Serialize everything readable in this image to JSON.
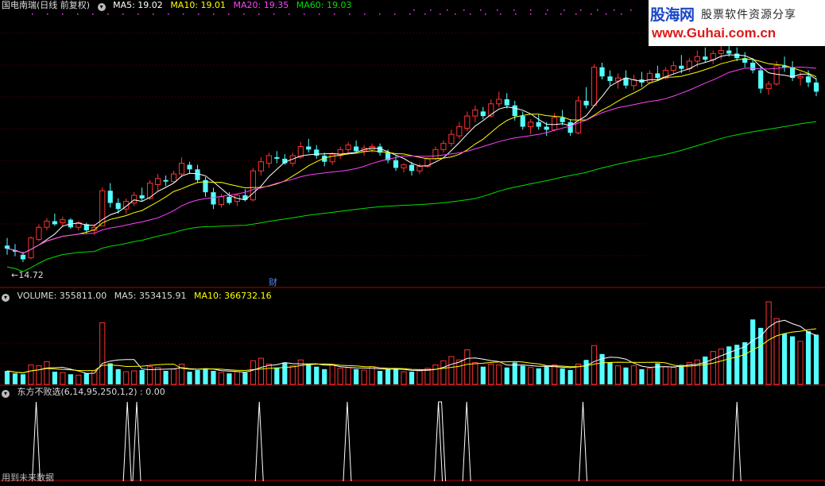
{
  "header": {
    "stock_name": "国电南瑞(日线 前复权)",
    "ma5": "MA5: 19.02",
    "ma10": "MA10: 19.01",
    "ma20": "MA20: 19.35",
    "ma60": "MA60: 19.03"
  },
  "volume_header": {
    "label": "VOLUME: 355811.00",
    "ma5": "MA5: 353415.91",
    "ma10": "MA10: 366732.16"
  },
  "indicator_header": {
    "label": "东方不败选(6,14,95,250,1,2)  : 0.00"
  },
  "logo": {
    "brand": "股海网",
    "slogan": "股票软件资源分享",
    "url": "www.Guhai.com.cn"
  },
  "low_marker": "←14.72",
  "finance_badge": "财",
  "bottom_note": "用到未来数据",
  "colors": {
    "up": "#ff3232",
    "down": "#54ffff",
    "ma5": "#ffffff",
    "ma10": "#ffff00",
    "ma20": "#ff40ff",
    "ma60": "#00e000",
    "grid": "#6a0000",
    "signal": "#ffffff"
  },
  "chart_data": {
    "type": "candlestick",
    "price_min_visible": 14.72,
    "ohlc": [
      [
        15.8,
        16.3,
        15.2,
        15.6
      ],
      [
        15.5,
        15.9,
        15.1,
        15.4
      ],
      [
        15.2,
        15.4,
        14.72,
        14.9
      ],
      [
        15.0,
        16.4,
        14.9,
        16.3
      ],
      [
        16.2,
        17.2,
        16.1,
        17.0
      ],
      [
        17.0,
        17.6,
        16.8,
        17.4
      ],
      [
        17.4,
        17.9,
        17.1,
        17.2
      ],
      [
        17.3,
        17.7,
        17.0,
        17.5
      ],
      [
        17.5,
        17.6,
        16.9,
        17.0
      ],
      [
        17.0,
        17.4,
        16.8,
        17.3
      ],
      [
        17.2,
        17.3,
        16.6,
        16.8
      ],
      [
        16.8,
        17.2,
        16.5,
        17.0
      ],
      [
        17.1,
        19.6,
        17.1,
        19.4
      ],
      [
        19.4,
        19.9,
        18.3,
        18.6
      ],
      [
        18.6,
        18.9,
        17.9,
        18.2
      ],
      [
        18.2,
        18.9,
        17.9,
        18.7
      ],
      [
        18.6,
        19.3,
        18.4,
        19.1
      ],
      [
        19.1,
        19.6,
        18.7,
        18.9
      ],
      [
        18.9,
        20.1,
        18.8,
        19.9
      ],
      [
        19.8,
        20.5,
        19.4,
        20.2
      ],
      [
        20.1,
        20.4,
        19.7,
        20.0
      ],
      [
        20.0,
        20.7,
        19.9,
        20.5
      ],
      [
        20.5,
        21.6,
        20.3,
        21.2
      ],
      [
        21.1,
        21.3,
        20.5,
        20.8
      ],
      [
        20.8,
        21.1,
        19.9,
        20.1
      ],
      [
        20.1,
        20.3,
        19.0,
        19.3
      ],
      [
        19.3,
        19.6,
        18.2,
        18.5
      ],
      [
        18.5,
        19.2,
        18.3,
        19.0
      ],
      [
        19.0,
        19.3,
        18.5,
        18.6
      ],
      [
        18.7,
        19.2,
        18.4,
        19.1
      ],
      [
        19.1,
        19.5,
        18.7,
        18.8
      ],
      [
        18.8,
        20.9,
        18.7,
        20.7
      ],
      [
        20.7,
        21.6,
        20.4,
        21.3
      ],
      [
        21.2,
        21.9,
        20.9,
        21.7
      ],
      [
        21.6,
        22.0,
        21.2,
        21.5
      ],
      [
        21.5,
        21.8,
        21.1,
        21.2
      ],
      [
        21.2,
        21.9,
        21.0,
        21.7
      ],
      [
        21.6,
        22.6,
        21.5,
        22.3
      ],
      [
        22.3,
        22.8,
        21.9,
        22.1
      ],
      [
        22.1,
        22.4,
        21.5,
        21.7
      ],
      [
        21.7,
        21.9,
        21.0,
        21.3
      ],
      [
        21.3,
        21.9,
        21.1,
        21.8
      ],
      [
        21.7,
        22.3,
        21.5,
        22.1
      ],
      [
        22.1,
        22.6,
        21.8,
        22.4
      ],
      [
        22.3,
        22.7,
        21.9,
        22.0
      ],
      [
        22.0,
        22.4,
        21.7,
        22.2
      ],
      [
        22.1,
        22.5,
        21.9,
        22.3
      ],
      [
        22.3,
        22.5,
        21.7,
        21.9
      ],
      [
        21.9,
        22.1,
        21.2,
        21.4
      ],
      [
        21.4,
        21.7,
        20.7,
        20.9
      ],
      [
        20.9,
        21.2,
        20.6,
        21.1
      ],
      [
        21.1,
        21.3,
        20.4,
        20.7
      ],
      [
        20.7,
        21.2,
        20.5,
        21.0
      ],
      [
        21.0,
        21.6,
        20.9,
        21.5
      ],
      [
        21.5,
        22.3,
        21.4,
        22.1
      ],
      [
        22.1,
        22.7,
        21.9,
        22.5
      ],
      [
        22.5,
        23.4,
        22.3,
        23.1
      ],
      [
        23.0,
        23.9,
        22.8,
        23.6
      ],
      [
        23.5,
        24.6,
        23.3,
        24.3
      ],
      [
        24.3,
        25.0,
        23.9,
        24.7
      ],
      [
        24.6,
        24.9,
        24.1,
        24.3
      ],
      [
        24.3,
        25.4,
        24.2,
        25.1
      ],
      [
        25.1,
        25.9,
        24.9,
        25.4
      ],
      [
        25.4,
        25.8,
        24.8,
        25.0
      ],
      [
        25.0,
        25.3,
        24.0,
        24.3
      ],
      [
        24.3,
        24.6,
        23.4,
        23.6
      ],
      [
        23.6,
        24.1,
        23.1,
        23.9
      ],
      [
        23.9,
        24.4,
        23.4,
        23.6
      ],
      [
        23.6,
        23.9,
        23.0,
        23.4
      ],
      [
        23.4,
        24.5,
        23.3,
        24.2
      ],
      [
        24.2,
        24.7,
        23.7,
        23.9
      ],
      [
        23.9,
        24.1,
        23.0,
        23.2
      ],
      [
        23.2,
        25.6,
        23.1,
        25.3
      ],
      [
        25.3,
        26.2,
        24.8,
        25.0
      ],
      [
        25.0,
        27.7,
        25.0,
        27.5
      ],
      [
        27.5,
        27.8,
        26.7,
        26.9
      ],
      [
        26.9,
        27.3,
        26.3,
        26.6
      ],
      [
        26.6,
        27.1,
        26.1,
        26.8
      ],
      [
        26.8,
        27.3,
        26.1,
        26.3
      ],
      [
        26.3,
        27.0,
        26.0,
        26.7
      ],
      [
        26.7,
        27.2,
        26.2,
        26.5
      ],
      [
        26.5,
        27.3,
        26.4,
        27.1
      ],
      [
        27.1,
        27.6,
        26.6,
        26.8
      ],
      [
        26.8,
        27.5,
        26.7,
        27.3
      ],
      [
        27.3,
        27.9,
        27.0,
        27.6
      ],
      [
        27.6,
        28.3,
        27.1,
        27.4
      ],
      [
        27.4,
        28.1,
        27.2,
        27.9
      ],
      [
        27.9,
        28.6,
        27.5,
        28.2
      ],
      [
        28.2,
        28.8,
        27.8,
        28.0
      ],
      [
        28.0,
        28.6,
        27.7,
        28.4
      ],
      [
        28.4,
        28.9,
        28.0,
        28.6
      ],
      [
        28.6,
        29.1,
        28.2,
        28.4
      ],
      [
        28.4,
        28.8,
        27.9,
        28.1
      ],
      [
        28.1,
        28.5,
        27.5,
        27.8
      ],
      [
        27.8,
        28.1,
        27.1,
        27.3
      ],
      [
        27.3,
        27.6,
        25.8,
        26.1
      ],
      [
        26.1,
        26.6,
        25.7,
        26.4
      ],
      [
        26.4,
        27.9,
        26.3,
        27.6
      ],
      [
        27.6,
        28.2,
        27.2,
        27.5
      ],
      [
        27.5,
        27.9,
        26.6,
        26.8
      ],
      [
        26.8,
        27.2,
        26.3,
        26.9
      ],
      [
        26.9,
        27.3,
        26.2,
        26.5
      ],
      [
        26.5,
        26.8,
        25.6,
        25.9
      ]
    ],
    "volume": [
      1.6,
      1.3,
      1.2,
      2.3,
      2.2,
      2.7,
      1.5,
      1.4,
      1.2,
      1.1,
      1.3,
      1.6,
      7.3,
      2.5,
      1.8,
      1.5,
      1.6,
      1.7,
      2.1,
      2.0,
      1.6,
      1.8,
      2.4,
      1.5,
      1.7,
      1.9,
      1.6,
      1.4,
      1.3,
      1.5,
      1.4,
      2.8,
      3.1,
      2.4,
      2.0,
      2.6,
      2.2,
      2.9,
      2.4,
      2.1,
      1.8,
      2.3,
      1.9,
      2.0,
      1.8,
      1.7,
      2.1,
      1.6,
      1.8,
      1.9,
      1.5,
      1.5,
      1.6,
      1.9,
      2.3,
      2.8,
      3.3,
      2.9,
      4.1,
      2.6,
      2.1,
      2.4,
      2.3,
      2.0,
      2.6,
      2.2,
      2.0,
      1.9,
      2.1,
      2.3,
      1.9,
      1.7,
      2.4,
      2.9,
      4.6,
      3.6,
      2.6,
      2.2,
      2.0,
      2.2,
      1.8,
      1.9,
      2.5,
      2.1,
      2.0,
      2.3,
      2.6,
      2.9,
      3.3,
      3.9,
      4.2,
      4.5,
      4.7,
      5.0,
      7.7,
      6.7,
      9.8,
      7.8,
      6.0,
      5.7,
      5.1,
      6.3,
      5.9
    ],
    "signal_bars": [
      10,
      39,
      42,
      81,
      109,
      138,
      139,
      147,
      184,
      233
    ],
    "signal_total": 260
  }
}
